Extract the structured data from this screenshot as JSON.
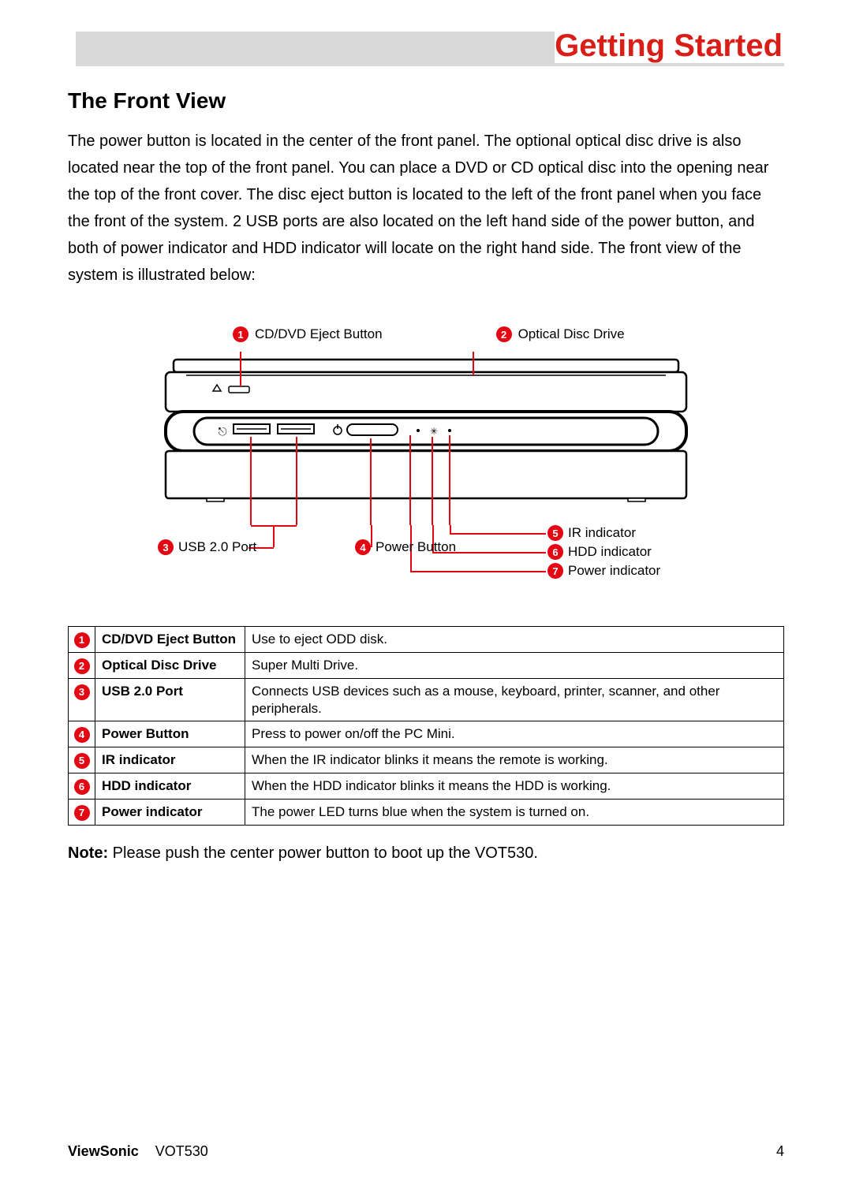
{
  "header": {
    "title": "Getting Started"
  },
  "section": {
    "title": "The Front View"
  },
  "body": "The power button is located in the center of the front panel. The optional optical disc drive is also located near the top of the front panel. You can place a DVD or CD optical disc into the opening near the top of the front cover. The disc eject button is located to the left of the front panel when you face the front of the system. 2 USB ports are also located on the left hand side of  the power button, and both of  power indicator and HDD indicator will locate on the right hand side. The front view of the system is illustrated below:",
  "callouts_top": [
    {
      "num": "1",
      "label": "CD/DVD Eject Button"
    },
    {
      "num": "2",
      "label": "Optical Disc Drive"
    }
  ],
  "callouts_bottom_left": [
    {
      "num": "3",
      "label": "USB 2.0 Port"
    },
    {
      "num": "4",
      "label": "Power Button"
    }
  ],
  "callouts_bottom_right": [
    {
      "num": "5",
      "label": "IR indicator"
    },
    {
      "num": "6",
      "label": "HDD indicator"
    },
    {
      "num": "7",
      "label": "Power indicator"
    }
  ],
  "table": [
    {
      "num": "1",
      "feature": "CD/DVD Eject Button",
      "desc": "Use to eject ODD disk."
    },
    {
      "num": "2",
      "feature": "Optical Disc Drive",
      "desc": "Super Multi Drive."
    },
    {
      "num": "3",
      "feature": "USB 2.0 Port",
      "desc": "Connects USB devices such as a mouse, keyboard, printer, scanner, and other peripherals."
    },
    {
      "num": "4",
      "feature": "Power Button",
      "desc": "Press to power on/off the PC Mini."
    },
    {
      "num": "5",
      "feature": "IR indicator",
      "desc": "When the IR indicator blinks it means the remote is working."
    },
    {
      "num": "6",
      "feature": "HDD indicator",
      "desc": "When the HDD indicator blinks it means the HDD is working."
    },
    {
      "num": "7",
      "feature": "Power indicator",
      "desc": "The power LED turns blue when the system is turned on."
    }
  ],
  "note": {
    "label": "Note:",
    "text": " Please push the center power button to boot up the VOT530."
  },
  "footer": {
    "brand": "ViewSonic",
    "model": "VOT530",
    "page": "4"
  }
}
